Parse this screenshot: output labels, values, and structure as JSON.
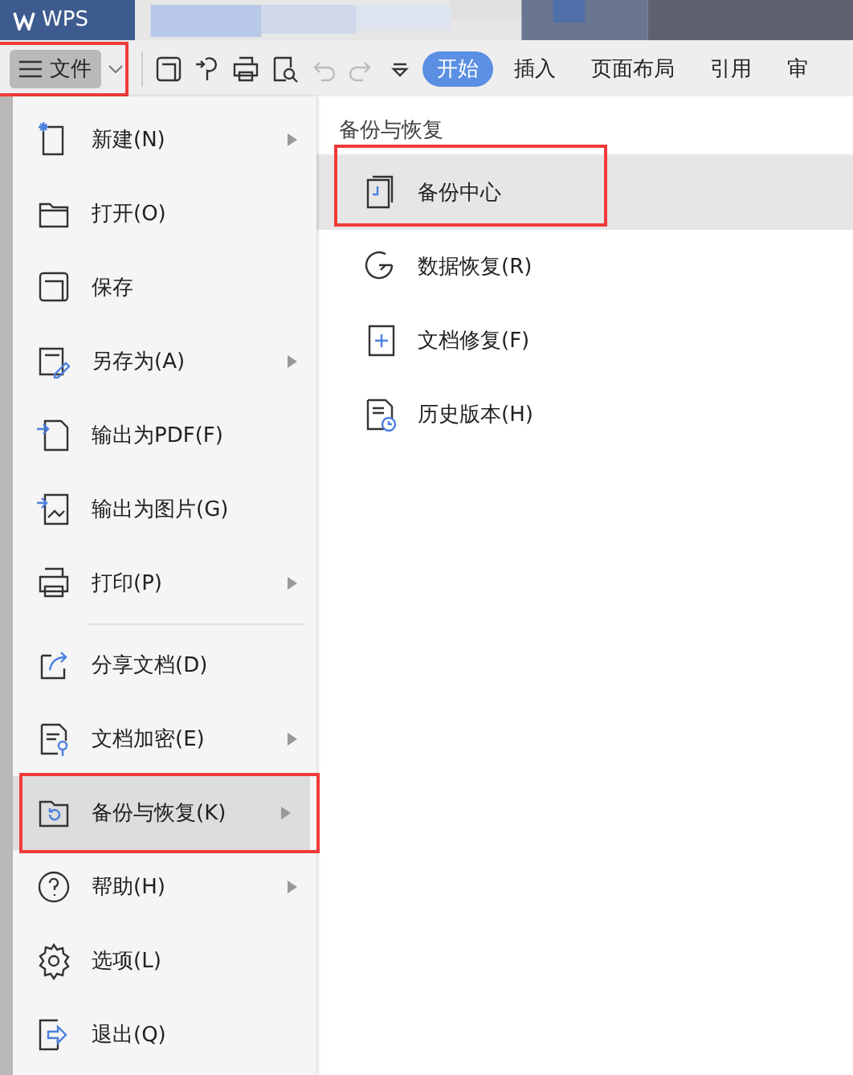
{
  "title_bar": {
    "app_name": "WPS"
  },
  "toolbar": {
    "file_button": {
      "label": "文件",
      "highlighted": true
    },
    "tabs": [
      {
        "label": "开始",
        "selected": true
      },
      {
        "label": "插入",
        "selected": false
      },
      {
        "label": "页面布局",
        "selected": false
      },
      {
        "label": "引用",
        "selected": false
      },
      {
        "label": "审",
        "selected": false
      }
    ]
  },
  "menu": {
    "items": [
      {
        "kind": "item",
        "label": "新建(N)",
        "submenu": true,
        "selected": false,
        "highlighted": false
      },
      {
        "kind": "item",
        "label": "打开(O)",
        "submenu": false,
        "selected": false,
        "highlighted": false
      },
      {
        "kind": "item",
        "label": "保存",
        "submenu": false,
        "selected": false,
        "highlighted": false
      },
      {
        "kind": "item",
        "label": "另存为(A)",
        "submenu": true,
        "selected": false,
        "highlighted": false
      },
      {
        "kind": "item",
        "label": "输出为PDF(F)",
        "submenu": false,
        "selected": false,
        "highlighted": false
      },
      {
        "kind": "item",
        "label": "输出为图片(G)",
        "submenu": false,
        "selected": false,
        "highlighted": false
      },
      {
        "kind": "item",
        "label": "打印(P)",
        "submenu": true,
        "selected": false,
        "highlighted": false
      },
      {
        "kind": "separator"
      },
      {
        "kind": "item",
        "label": "分享文档(D)",
        "submenu": false,
        "selected": false,
        "highlighted": false
      },
      {
        "kind": "item",
        "label": "文档加密(E)",
        "submenu": true,
        "selected": false,
        "highlighted": false
      },
      {
        "kind": "item",
        "label": "备份与恢复(K)",
        "submenu": true,
        "selected": true,
        "highlighted": true
      },
      {
        "kind": "item",
        "label": "帮助(H)",
        "submenu": true,
        "selected": false,
        "highlighted": false
      },
      {
        "kind": "item",
        "label": "选项(L)",
        "submenu": false,
        "selected": false,
        "highlighted": false
      },
      {
        "kind": "item",
        "label": "退出(Q)",
        "submenu": false,
        "selected": false,
        "highlighted": false
      }
    ]
  },
  "submenu": {
    "title": "备份与恢复",
    "items": [
      {
        "label": "备份中心",
        "selected": true,
        "highlighted": true
      },
      {
        "label": "数据恢复(R)",
        "selected": false,
        "highlighted": false
      },
      {
        "label": "文档修复(F)",
        "selected": false,
        "highlighted": false
      },
      {
        "label": "历史版本(H)",
        "selected": false,
        "highlighted": false
      }
    ]
  }
}
